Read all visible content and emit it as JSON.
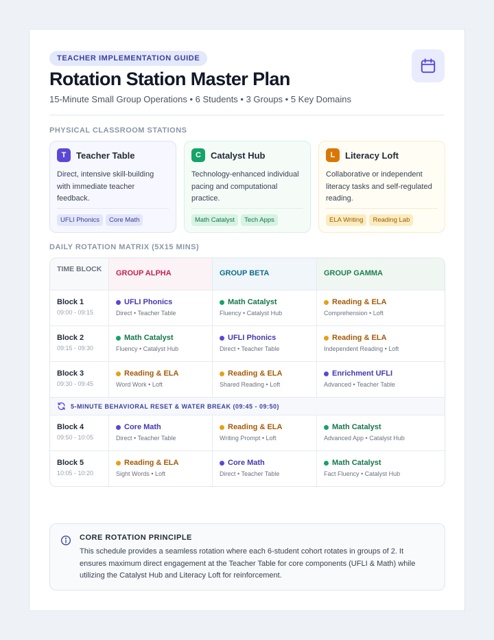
{
  "header": {
    "badge": "TEACHER IMPLEMENTATION GUIDE",
    "title": "Rotation Station Master Plan",
    "subtitle": "15-Minute Small Group Operations • 6 Students • 3 Groups • 5 Key Domains",
    "icon": "calendar-icon"
  },
  "stations": {
    "section_label": "PHYSICAL CLASSROOM STATIONS",
    "cards": [
      {
        "letter": "T",
        "title": "Teacher Table",
        "desc": "Direct, intensive skill-building with immediate teacher feedback.",
        "tags": [
          "UFLI Phonics",
          "Core Math"
        ],
        "accent": "#5b47d6"
      },
      {
        "letter": "C",
        "title": "Catalyst Hub",
        "desc": "Technology-enhanced individual pacing and computational practice.",
        "tags": [
          "Math Catalyst",
          "Tech Apps"
        ],
        "accent": "#16a36a"
      },
      {
        "letter": "L",
        "title": "Literacy Loft",
        "desc": "Collaborative or independent literacy tasks and self-regulated reading.",
        "tags": [
          "ELA Writing",
          "Reading Lab"
        ],
        "accent": "#d97706"
      }
    ]
  },
  "matrix": {
    "section_label": "DAILY ROTATION MATRIX (5X15 MINS)",
    "col_time": "TIME BLOCK",
    "groups": [
      "GROUP ALPHA",
      "GROUP BETA",
      "GROUP GAMMA"
    ],
    "rows": [
      {
        "block": "Block 1",
        "time": "09:00 - 09:15",
        "cells": [
          {
            "name": "UFLI Phonics",
            "sub": "Direct • Teacher Table",
            "kind": "teacher"
          },
          {
            "name": "Math Catalyst",
            "sub": "Fluency • Catalyst Hub",
            "kind": "catalyst"
          },
          {
            "name": "Reading & ELA",
            "sub": "Comprehension • Loft",
            "kind": "loft"
          }
        ]
      },
      {
        "block": "Block 2",
        "time": "09:15 - 09:30",
        "cells": [
          {
            "name": "Math Catalyst",
            "sub": "Fluency • Catalyst Hub",
            "kind": "catalyst"
          },
          {
            "name": "UFLI Phonics",
            "sub": "Direct • Teacher Table",
            "kind": "teacher"
          },
          {
            "name": "Reading & ELA",
            "sub": "Independent Reading • Loft",
            "kind": "loft"
          }
        ]
      },
      {
        "block": "Block 3",
        "time": "09:30 - 09:45",
        "cells": [
          {
            "name": "Reading & ELA",
            "sub": "Word Work • Loft",
            "kind": "loft"
          },
          {
            "name": "Reading & ELA",
            "sub": "Shared Reading • Loft",
            "kind": "loft"
          },
          {
            "name": "Enrichment UFLI",
            "sub": "Advanced • Teacher Table",
            "kind": "teacher"
          }
        ]
      },
      {
        "reset": "5-MINUTE BEHAVIORAL RESET & WATER BREAK (09:45 - 09:50)"
      },
      {
        "block": "Block 4",
        "time": "09:50 - 10:05",
        "cells": [
          {
            "name": "Core Math",
            "sub": "Direct • Teacher Table",
            "kind": "teacher"
          },
          {
            "name": "Reading & ELA",
            "sub": "Writing Prompt • Loft",
            "kind": "loft"
          },
          {
            "name": "Math Catalyst",
            "sub": "Advanced App • Catalyst Hub",
            "kind": "catalyst"
          }
        ]
      },
      {
        "block": "Block 5",
        "time": "10:05 - 10:20",
        "cells": [
          {
            "name": "Reading & ELA",
            "sub": "Sight Words • Loft",
            "kind": "loft"
          },
          {
            "name": "Core Math",
            "sub": "Direct • Teacher Table",
            "kind": "teacher"
          },
          {
            "name": "Math Catalyst",
            "sub": "Fact Fluency • Catalyst Hub",
            "kind": "catalyst"
          }
        ]
      }
    ]
  },
  "principle": {
    "title": "CORE ROTATION PRINCIPLE",
    "body": "This schedule provides a seamless rotation where each 6-student cohort rotates in groups of 2. It ensures maximum direct engagement at the Teacher Table for core components (UFLI & Math) while utilizing the Catalyst Hub and Literacy Loft for reinforcement.",
    "icon": "info-icon"
  },
  "colors": {
    "teacher": "#5b47d6",
    "catalyst": "#16a36a",
    "loft": "#d97706",
    "alpha": "#c0244f",
    "beta": "#0e6d8c",
    "gamma": "#1a7f4b"
  }
}
